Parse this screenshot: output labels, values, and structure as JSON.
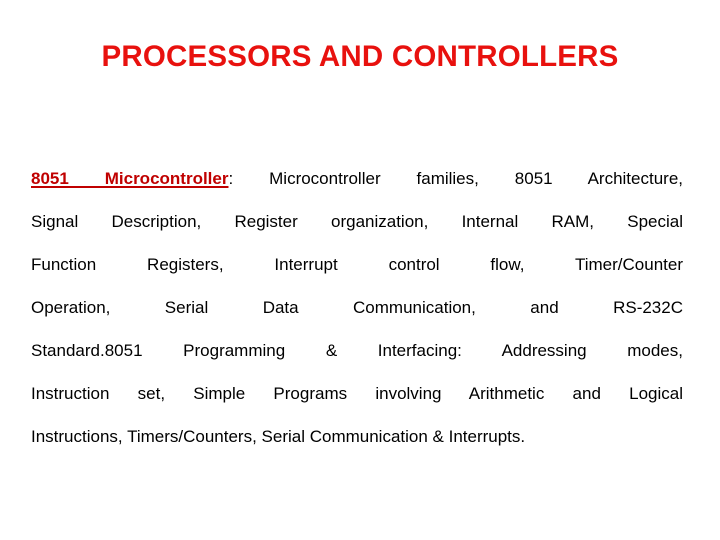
{
  "slide": {
    "title": "PROCESSORS AND CONTROLLERS",
    "title_color": "#e8110e",
    "background_color": "#ffffff",
    "body_text_color": "#000000",
    "term_color": "#c00000"
  },
  "body": {
    "term": "8051 Microcontroller",
    "term_separator": ":",
    "lines": [
      " Microcontroller families, 8051 Architecture,",
      "Signal Description, Register organization, Internal RAM, Special",
      "Function Registers, Interrupt control flow, Timer/Counter",
      "Operation, Serial Data Communication, and RS-232C",
      "Standard.8051 Programming & Interfacing: Addressing modes,",
      "Instruction set, Simple Programs involving Arithmetic and Logical",
      "Instructions, Timers/Counters, Serial Communication & Interrupts."
    ],
    "full_text": "8051 Microcontroller: Microcontroller families, 8051 Architecture, Signal Description, Register organization, Internal RAM, Special Function Registers, Interrupt control flow, Timer/Counter Operation, Serial Data Communication, and RS-232C Standard.8051 Programming & Interfacing: Addressing modes, Instruction set, Simple Programs involving Arithmetic and Logical Instructions, Timers/Counters, Serial Communication & Interrupts."
  }
}
